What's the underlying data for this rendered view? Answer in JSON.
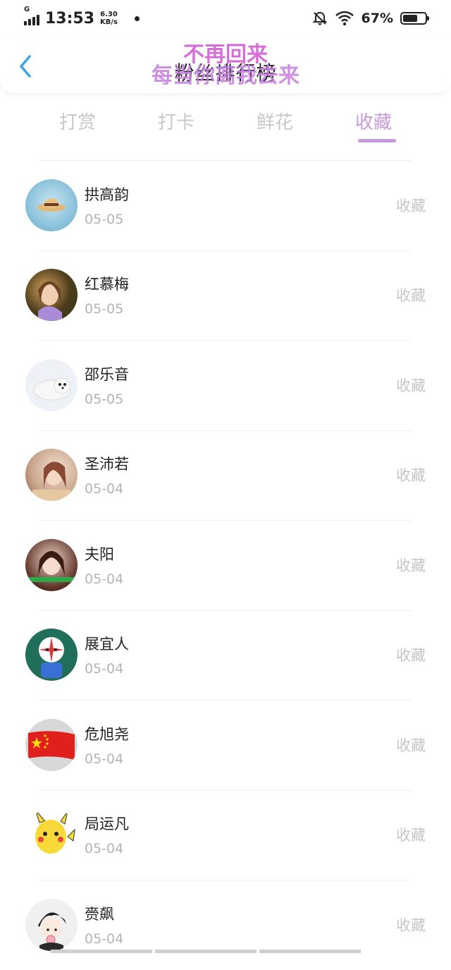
{
  "status": {
    "time": "13:53",
    "net_type": "G",
    "speed_value": "6.30",
    "speed_unit": "KB/s",
    "battery": "67%",
    "battery_level": 0.67
  },
  "header": {
    "title": "粉丝排行榜",
    "overlay_top": "不再回来",
    "overlay_bottom": "每当你离我去来"
  },
  "tabs": [
    {
      "label": "打赏",
      "active": false
    },
    {
      "label": "打卡",
      "active": false
    },
    {
      "label": "鲜花",
      "active": false
    },
    {
      "label": "收藏",
      "active": true
    }
  ],
  "list": [
    {
      "name": "拱高韵",
      "date": "05-05",
      "action": "收藏",
      "avatar": "hat-photo-avatar"
    },
    {
      "name": "红慕梅",
      "date": "05-05",
      "action": "收藏",
      "avatar": "woman-portrait-avatar"
    },
    {
      "name": "邵乐音",
      "date": "05-05",
      "action": "收藏",
      "avatar": "seal-pup-avatar"
    },
    {
      "name": "圣沛若",
      "date": "05-04",
      "action": "收藏",
      "avatar": "girl-portrait-avatar"
    },
    {
      "name": "夫阳",
      "date": "05-04",
      "action": "收藏",
      "avatar": "girl-closeup-avatar"
    },
    {
      "name": "展宜人",
      "date": "05-04",
      "action": "收藏",
      "avatar": "cartoon-character-avatar"
    },
    {
      "name": "危旭尧",
      "date": "05-04",
      "action": "收藏",
      "avatar": "china-flag-avatar"
    },
    {
      "name": "局运凡",
      "date": "05-04",
      "action": "收藏",
      "avatar": "pikachu-avatar"
    },
    {
      "name": "赍飙",
      "date": "05-04",
      "action": "收藏",
      "avatar": "anime-boy-avatar"
    }
  ]
}
